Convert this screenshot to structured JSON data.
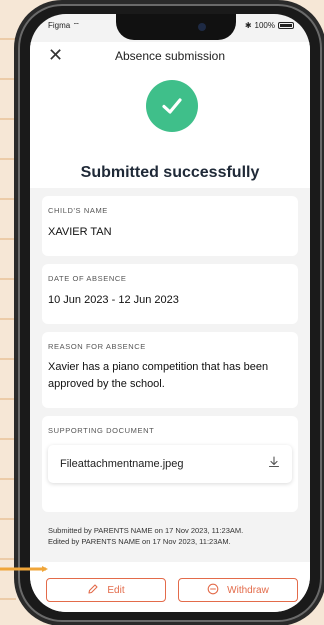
{
  "status_bar": {
    "carrier": "Figma",
    "battery": "100%"
  },
  "header": {
    "title": "Absence submission"
  },
  "hero": {
    "headline": "Submitted successfully"
  },
  "fields": {
    "child_name": {
      "label": "CHILD'S NAME",
      "value": "XAVIER TAN"
    },
    "date": {
      "label": "DATE OF ABSENCE",
      "value": "10 Jun 2023 - 12 Jun 2023"
    },
    "reason": {
      "label": "REASON FOR ABSENCE",
      "value": "Xavier has a piano competition that has been approved by the school."
    },
    "document": {
      "label": "SUPPORTING DOCUMENT",
      "file_name": "Fileattachmentname.jpeg"
    }
  },
  "meta": {
    "submitted": "Submitted by PARENTS NAME on 17 Nov 2023, 11:23AM.",
    "edited": "Edited by PARENTS NAME on 17 Nov 2023, 11:23AM."
  },
  "actions": {
    "edit_label": "Edit",
    "withdraw_label": "Withdraw"
  },
  "colors": {
    "accent": "#e36b4a",
    "success": "#3fbf8a",
    "highlight_arrow": "#f0a63a"
  }
}
